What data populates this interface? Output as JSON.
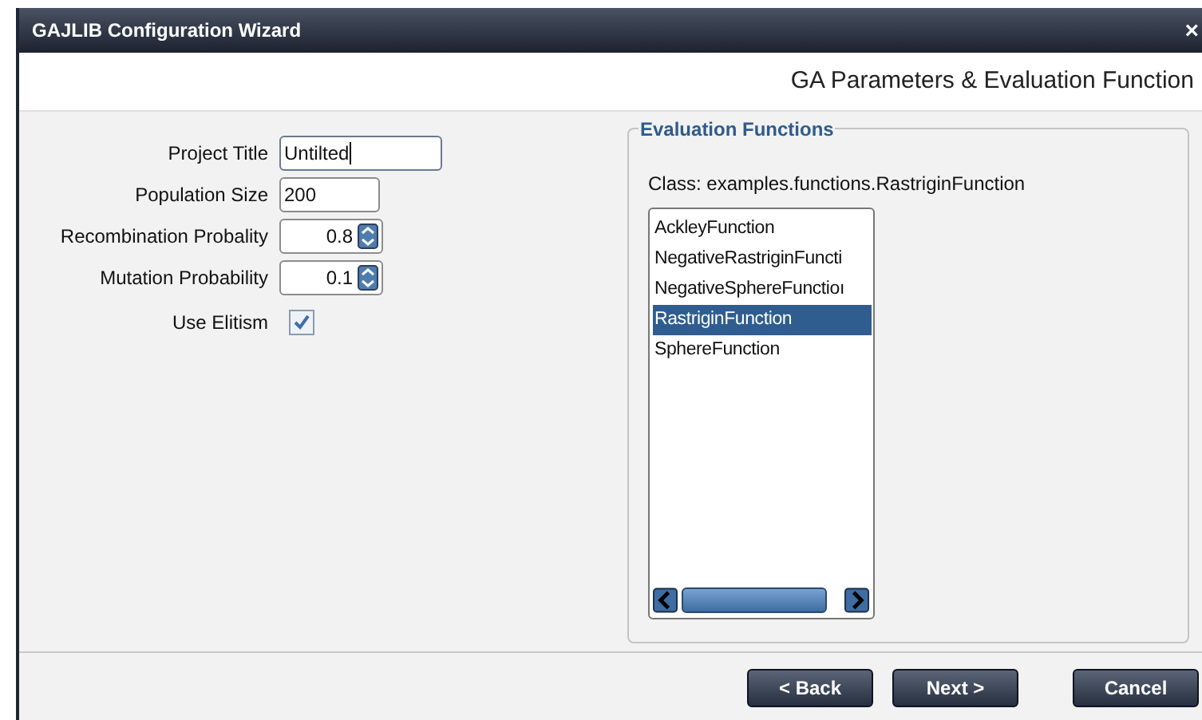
{
  "window": {
    "title": "GAJLIB Configuration Wizard",
    "close": "×"
  },
  "header": {
    "title": "GA Parameters & Evaluation Function"
  },
  "fields": [
    {
      "kind": "text",
      "label": "Project Title",
      "value": "Untilted",
      "focused": true
    },
    {
      "kind": "text",
      "label": "Population Size",
      "value": "200",
      "focused": false
    },
    {
      "kind": "spinner",
      "label": "Recombination Probality",
      "value": "0.8"
    },
    {
      "kind": "spinner",
      "label": "Mutation Probability",
      "value": "0.1"
    },
    {
      "kind": "checkbox",
      "label": "Use Elitism",
      "checked": true
    }
  ],
  "evaluation": {
    "legend": "Evaluation Functions",
    "class_label": "Class: examples.functions.RastriginFunction",
    "items": [
      {
        "label": "AckleyFunction",
        "selected": false
      },
      {
        "label": "NegativeRastriginFuncti",
        "selected": false
      },
      {
        "label": "NegativeSphereFunctioı",
        "selected": false
      },
      {
        "label": "RastriginFunction",
        "selected": true
      },
      {
        "label": "SphereFunction",
        "selected": false
      }
    ]
  },
  "buttons": [
    {
      "label": "< Back"
    },
    {
      "label": "Next >"
    },
    {
      "label": "Cancel"
    }
  ]
}
